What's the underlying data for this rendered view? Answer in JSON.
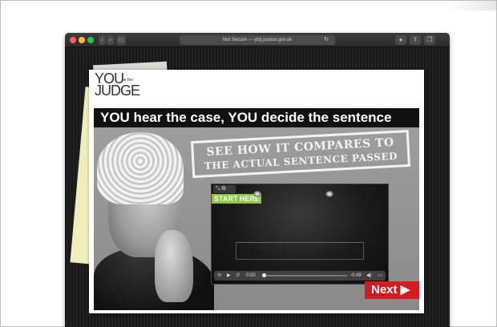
{
  "browser": {
    "address": "Not Secure — ybtj.justice.gov.uk",
    "reload_icon": "reload-icon",
    "back_icon": "chevron-left-icon",
    "forward_icon": "chevron-right-icon",
    "sidebar_icon": "sidebar-icon",
    "toolbar_icons": [
      "info-icon",
      "share-icon",
      "tabs-icon"
    ]
  },
  "logo": {
    "you": "YOU",
    "be_the": "be the",
    "judge": "JUDGE"
  },
  "headline": "YOU hear the case, YOU decide the sentence",
  "stamp": {
    "line1": "SEE HOW IT COMPARES TO",
    "line2": "THE ACTUAL SENTENCE PASSED"
  },
  "video": {
    "start_label": "START HERE",
    "current_time": "0:00",
    "remaining_time": "-0:49",
    "progress": 0
  },
  "next_button": "Next ▶",
  "colors": {
    "headline_bg": "#111111",
    "start_label_bg": "#8dc63f",
    "next_bg": "#d71920"
  }
}
